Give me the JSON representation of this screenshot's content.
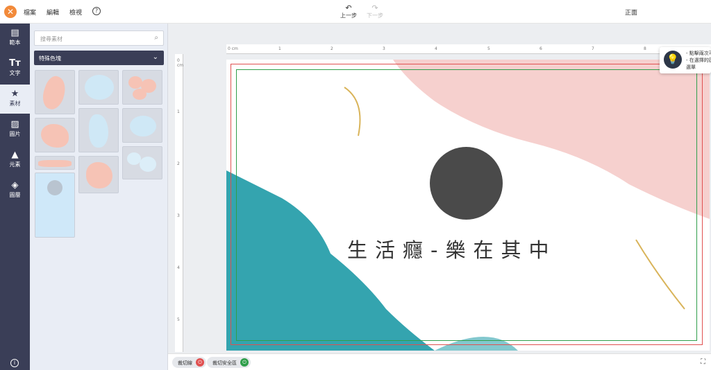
{
  "topbar": {
    "logo": "✕",
    "menu": [
      "檔案",
      "編輯",
      "檢視"
    ],
    "help": "?",
    "undo_icon": "↶",
    "undo_label": "上一步",
    "redo_icon": "↷",
    "redo_label": "下一步",
    "side_label": "正面"
  },
  "leftnav": {
    "items": [
      {
        "icon": "▤",
        "label": "範本"
      },
      {
        "icon": "Tт",
        "label": "文字"
      },
      {
        "icon": "★",
        "label": "素材"
      },
      {
        "icon": "▨",
        "label": "圖片"
      },
      {
        "icon": "▲",
        "label": "元素"
      },
      {
        "icon": "◈",
        "label": "圖層"
      }
    ],
    "info": "i"
  },
  "panel": {
    "search_placeholder": "搜尋素材",
    "search_icon": "⌕",
    "dropdown_label": "特殊色塊",
    "dropdown_chevron": "⌄"
  },
  "ruler": {
    "top": [
      "0 cm",
      "1",
      "2",
      "3",
      "4",
      "5",
      "6",
      "7",
      "8"
    ],
    "left": [
      "0 cm",
      "1",
      "2",
      "3",
      "4",
      "5"
    ]
  },
  "artboard": {
    "headline": "生活癮-樂在其中"
  },
  "tip": {
    "bulb": "💡",
    "lines": [
      "- 點擊兩次可",
      "- 在選擇的區",
      "選單"
    ]
  },
  "bottombar": {
    "cut_label": "裁切線",
    "safe_label": "裁切安全區",
    "fullscreen": "⛶"
  },
  "colors": {
    "nav_bg": "#3a3e57",
    "logo": "#f28a3a",
    "cut_line": "#e05050",
    "safe_line": "#2f9e4a",
    "teal": "#1e9aa6",
    "pink": "#f3c2c2",
    "gold": "#d9b45a"
  }
}
